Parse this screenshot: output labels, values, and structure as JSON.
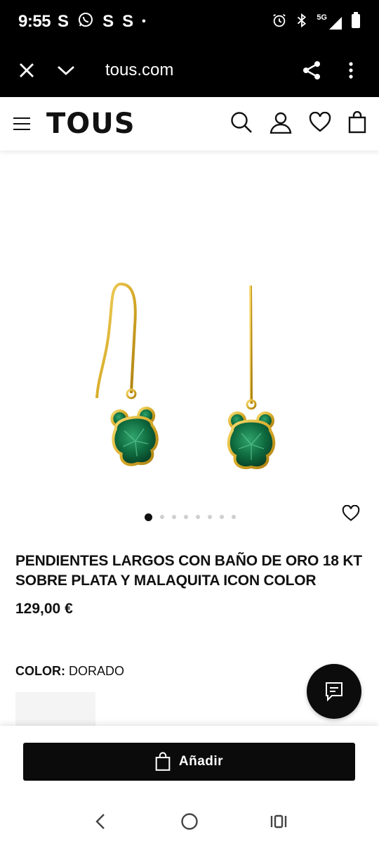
{
  "status_bar": {
    "time": "9:55",
    "notifications": [
      "S",
      "whatsapp",
      "S",
      "S",
      "•"
    ],
    "network": "5G"
  },
  "browser": {
    "url": "tous.com",
    "icons": [
      "close-icon",
      "chevron-down-icon",
      "share-icon",
      "more-vert-icon"
    ]
  },
  "site_header": {
    "logo": "TOUS",
    "icons": [
      "menu-icon",
      "search-icon",
      "user-icon",
      "heart-icon",
      "shopping-bag-icon"
    ]
  },
  "product": {
    "title": "PENDIENTES LARGOS CON BAÑO DE ORO 18 KT SOBRE PLATA Y MALAQUITA ICON COLOR",
    "price": "129,00 €",
    "color_label": "COLOR:",
    "color_value": "DORADO",
    "image_count": 8,
    "active_image": 1,
    "colors": {
      "gold": "#d9ad2b",
      "malachite": "#0f6b3f"
    }
  },
  "cart": {
    "add_label": "Añadir"
  },
  "colors": {
    "bar_bg": "#000000",
    "accent_dark": "#0b0b0b"
  }
}
